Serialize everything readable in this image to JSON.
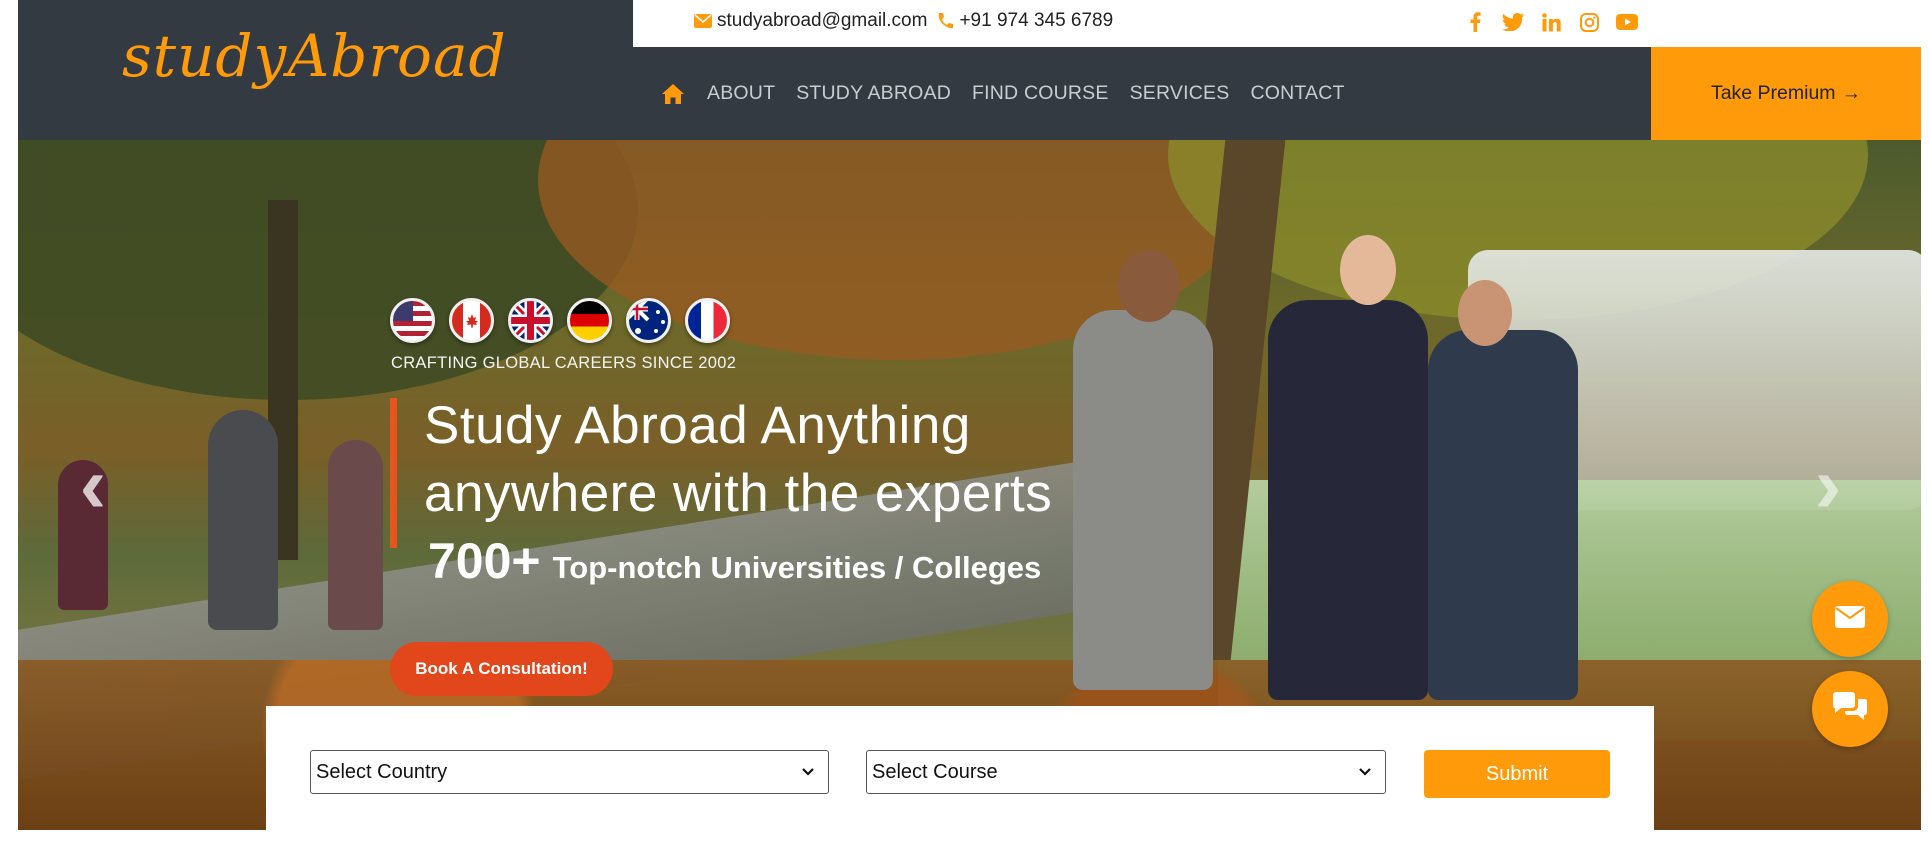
{
  "brand": {
    "logo_text": "studyAbroad"
  },
  "topbar": {
    "email": "studyabroad@gmail.com",
    "phone": "+91 974 345 6789",
    "social": [
      "facebook-icon",
      "twitter-icon",
      "linkedin-icon",
      "instagram-icon",
      "youtube-icon"
    ]
  },
  "nav": {
    "items": [
      {
        "label": "ABOUT"
      },
      {
        "label": "STUDY ABROAD"
      },
      {
        "label": "FIND COURSE"
      },
      {
        "label": "SERVICES"
      },
      {
        "label": "CONTACT"
      }
    ],
    "premium_label": "Take Premium",
    "premium_arrow": "→"
  },
  "hero": {
    "flags": [
      "usa-flag-icon",
      "canada-flag-icon",
      "uk-flag-icon",
      "germany-flag-icon",
      "australia-flag-icon",
      "france-flag-icon"
    ],
    "tagline": "CRAFTING GLOBAL CAREERS SINCE 2002",
    "headline_line1": "Study Abroad Anything",
    "headline_line2": "anywhere with the experts",
    "count": "700+",
    "count_text": "Top-notch Universities / Colleges",
    "cta_label": "Book A Consultation!",
    "prev_glyph": "‹",
    "next_glyph": "›"
  },
  "search": {
    "country_selected": "Select Country",
    "course_selected": "Select Course",
    "submit_label": "Submit"
  },
  "colors": {
    "accent": "#ff9a0a",
    "header_bg": "#333a41",
    "cta": "#e2461b"
  }
}
